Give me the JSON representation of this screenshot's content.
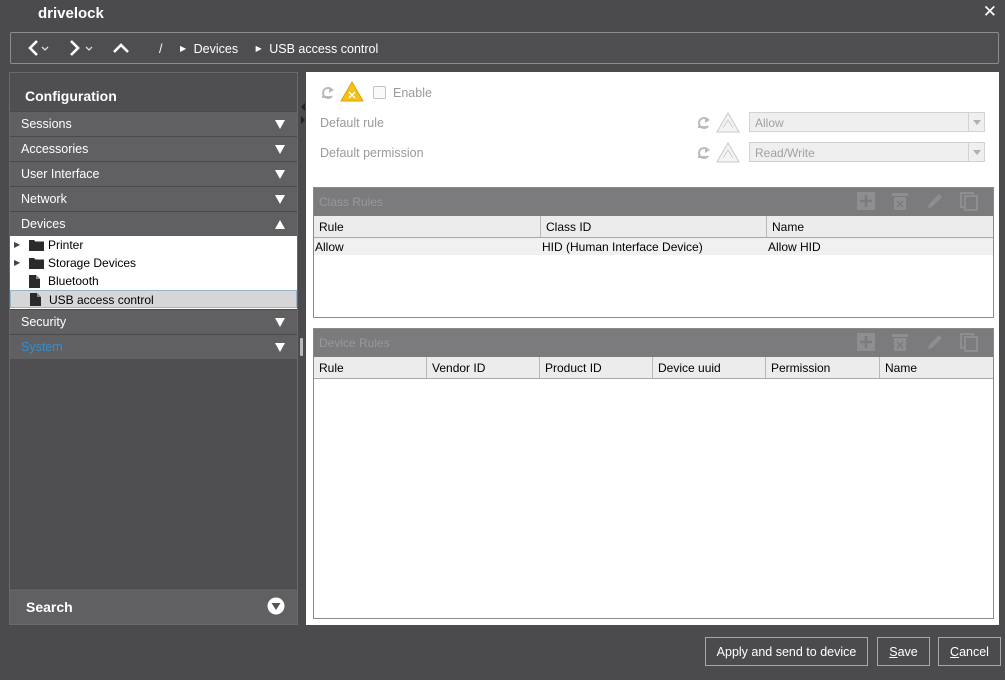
{
  "window": {
    "title": "drivelock",
    "close_glyph": "✕"
  },
  "nav": {
    "back_icon": "chevron-left-icon",
    "forward_icon": "chevron-right-icon",
    "up_icon": "chevron-up-icon",
    "breadcrumb_root": "/",
    "breadcrumb": [
      "Devices",
      "USB access control"
    ]
  },
  "sidebar": {
    "header": "Configuration",
    "sections": {
      "sessions": "Sessions",
      "accessories": "Accessories",
      "user_interface": "User Interface",
      "network": "Network",
      "devices": "Devices",
      "security": "Security",
      "system": "System"
    },
    "devices_tree": [
      {
        "label": "Printer",
        "type": "folder",
        "expandable": true
      },
      {
        "label": "Storage Devices",
        "type": "folder",
        "expandable": true
      },
      {
        "label": "Bluetooth",
        "type": "file",
        "expandable": false
      },
      {
        "label": "USB access control",
        "type": "file",
        "expandable": false,
        "selected": true
      }
    ],
    "search_label": "Search",
    "system_color": "#2f8fd6"
  },
  "main": {
    "enable_label": "Enable",
    "default_rule": {
      "label": "Default rule",
      "value": "Allow"
    },
    "default_permission": {
      "label": "Default permission",
      "value": "Read/Write"
    },
    "class_rules": {
      "title": "Class Rules",
      "columns": [
        "Rule",
        "Class ID",
        "Name"
      ],
      "rows": [
        {
          "rule": "Allow",
          "class_id": "HID (Human Interface Device)",
          "name": "Allow HID"
        }
      ]
    },
    "device_rules": {
      "title": "Device Rules",
      "columns": [
        "Rule",
        "Vendor ID",
        "Product ID",
        "Device uuid",
        "Permission",
        "Name"
      ],
      "rows": []
    },
    "toolbar_icons": [
      "add-icon",
      "delete-icon",
      "edit-icon",
      "copy-icon"
    ]
  },
  "footer": {
    "apply_label": "Apply and send to device",
    "save_label": "Save",
    "cancel_label": "Cancel"
  }
}
